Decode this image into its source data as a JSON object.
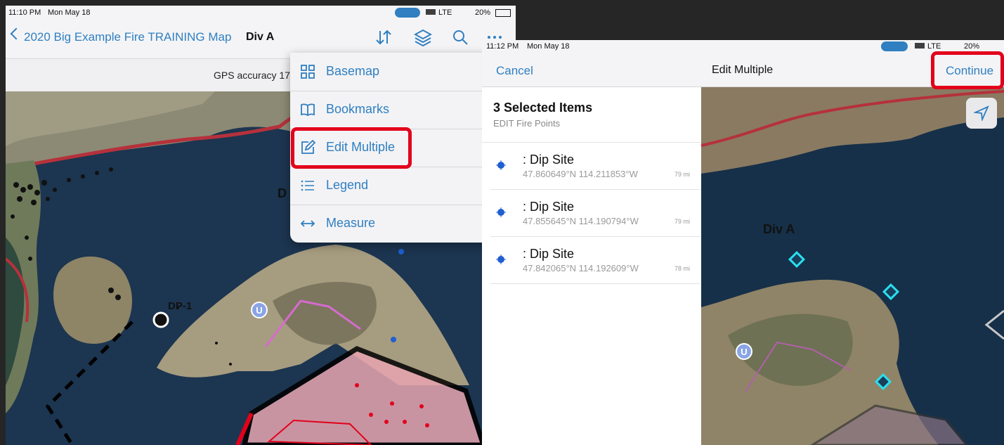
{
  "left_screen": {
    "status": {
      "time": "11:10 PM",
      "date": "Mon May 18",
      "network": "LTE",
      "battery": "20%"
    },
    "nav": {
      "back_label": "2020 Big Example Fire TRAINING Map",
      "title": "Div A"
    },
    "gps_text": "GPS accuracy 17",
    "menu": {
      "items": [
        {
          "label": "Basemap",
          "icon": "grid-icon"
        },
        {
          "label": "Bookmarks",
          "icon": "book-icon"
        },
        {
          "label": "Edit Multiple",
          "icon": "edit-icon",
          "highlighted": true
        },
        {
          "label": "Legend",
          "icon": "list-icon"
        },
        {
          "label": "Measure",
          "icon": "measure-arrows-icon"
        }
      ]
    },
    "map_labels": {
      "point_label": "DP-1",
      "partial_label": "D",
      "unit_marker": "U"
    }
  },
  "right_screen": {
    "status": {
      "time": "11:12 PM",
      "date": "Mon May 18",
      "network": "LTE",
      "battery": "20%"
    },
    "nav": {
      "cancel_label": "Cancel",
      "title": "Edit Multiple",
      "continue_label": "Continue"
    },
    "selection": {
      "heading": "3 Selected Items",
      "layer": "EDIT Fire Points",
      "items": [
        {
          "name": ": Dip Site",
          "coords": "47.860649°N  114.211853°W",
          "distance": "79 mi"
        },
        {
          "name": ": Dip Site",
          "coords": "47.855645°N  114.190794°W",
          "distance": "79 mi"
        },
        {
          "name": ": Dip Site",
          "coords": "47.842065°N  114.192609°W",
          "distance": "78 mi"
        }
      ]
    },
    "map_labels": {
      "division_label": "Div A",
      "unit_marker": "U"
    }
  },
  "colors": {
    "ios_blue": "#2f7fc1",
    "highlight_red": "#e3001b",
    "road_red": "#b5313b",
    "lake": "#1c3550"
  }
}
